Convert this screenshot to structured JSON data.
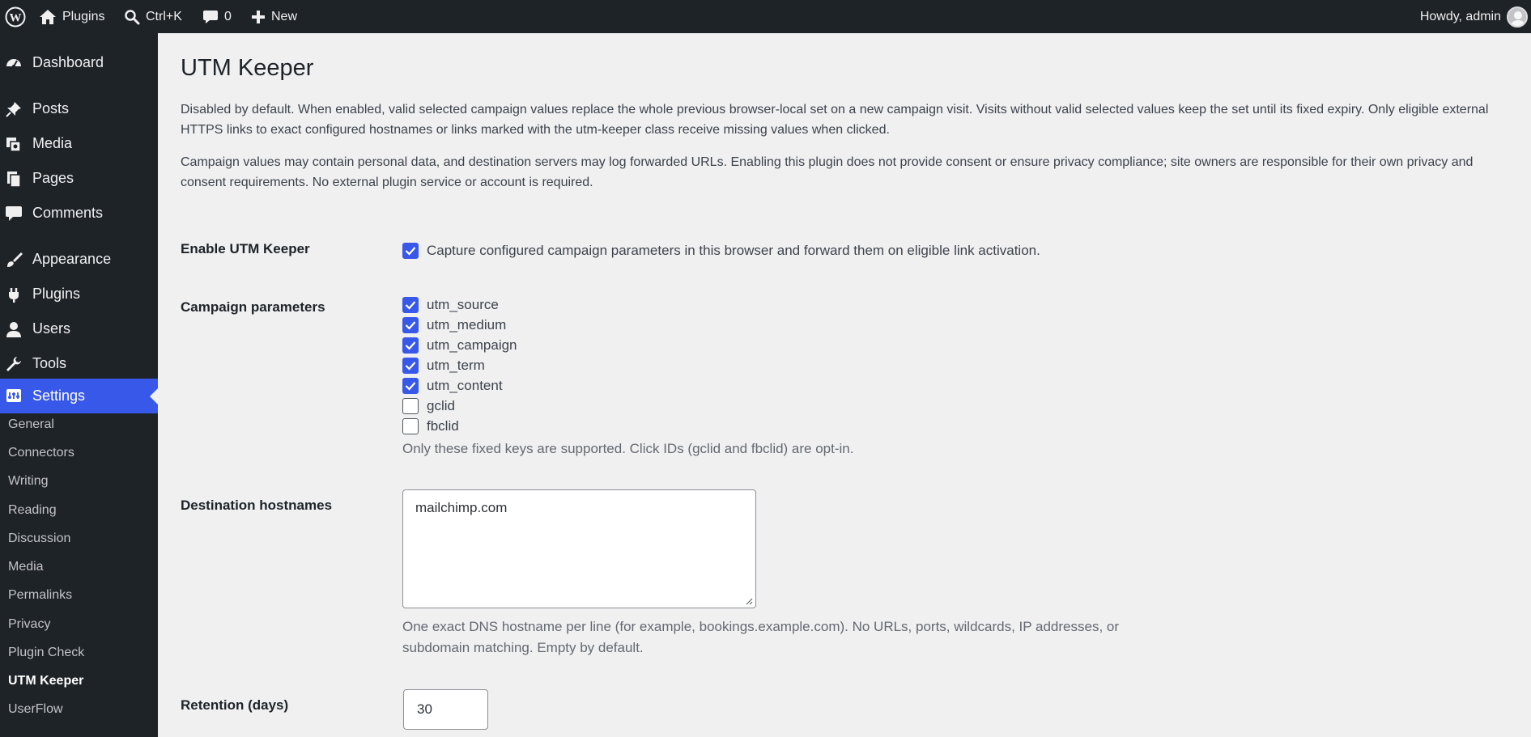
{
  "adminbar": {
    "site_label": "Plugins",
    "search_label": "Ctrl+K",
    "comments_count": "0",
    "new_label": "New",
    "account_label": "Howdy, admin"
  },
  "sidebar": {
    "items": [
      {
        "label": "Dashboard",
        "icon": "dashboard-icon"
      },
      {
        "label": "Posts",
        "icon": "pushpin-icon"
      },
      {
        "label": "Media",
        "icon": "media-icon"
      },
      {
        "label": "Pages",
        "icon": "pages-icon"
      },
      {
        "label": "Comments",
        "icon": "comments-icon"
      },
      {
        "label": "Appearance",
        "icon": "brush-icon"
      },
      {
        "label": "Plugins",
        "icon": "plug-icon"
      },
      {
        "label": "Users",
        "icon": "user-icon"
      },
      {
        "label": "Tools",
        "icon": "wrench-icon"
      },
      {
        "label": "Settings",
        "icon": "settings-icon"
      }
    ],
    "submenu": [
      "General",
      "Connectors",
      "Writing",
      "Reading",
      "Discussion",
      "Media",
      "Permalinks",
      "Privacy",
      "Plugin Check",
      "UTM Keeper",
      "UserFlow"
    ],
    "current_submenu": "UTM Keeper"
  },
  "page": {
    "title": "UTM Keeper",
    "description_1": "Disabled by default. When enabled, valid selected campaign values replace the whole previous browser-local set on a new campaign visit. Visits without valid selected values keep the set until its fixed expiry. Only eligible external HTTPS links to exact configured hostnames or links marked with the utm-keeper class receive missing values when clicked.",
    "description_2": "Campaign values may contain personal data, and destination servers may log forwarded URLs. Enabling this plugin does not provide consent or ensure privacy compliance; site owners are responsible for their own privacy and consent requirements. No external plugin service or account is required."
  },
  "settings": {
    "enable": {
      "label": "Enable UTM Keeper",
      "checkbox_label": "Capture configured campaign parameters in this browser and forward them on eligible link activation.",
      "checked": true
    },
    "params": {
      "label": "Campaign parameters",
      "options": [
        {
          "label": "utm_source",
          "checked": true
        },
        {
          "label": "utm_medium",
          "checked": true
        },
        {
          "label": "utm_campaign",
          "checked": true
        },
        {
          "label": "utm_term",
          "checked": true
        },
        {
          "label": "utm_content",
          "checked": true
        },
        {
          "label": "gclid",
          "checked": false
        },
        {
          "label": "fbclid",
          "checked": false
        }
      ],
      "help": "Only these fixed keys are supported. Click IDs (gclid and fbclid) are opt-in."
    },
    "hostnames": {
      "label": "Destination hostnames",
      "value": "mailchimp.com",
      "help": "One exact DNS hostname per line (for example, bookings.example.com). No URLs, ports, wildcards, IP addresses, or subdomain matching. Empty by default."
    },
    "retention": {
      "label": "Retention (days)",
      "value": "30"
    }
  },
  "colors": {
    "adminbar_bg": "#1d2327",
    "accent": "#3858e9",
    "content_bg": "#f0f0f1"
  }
}
